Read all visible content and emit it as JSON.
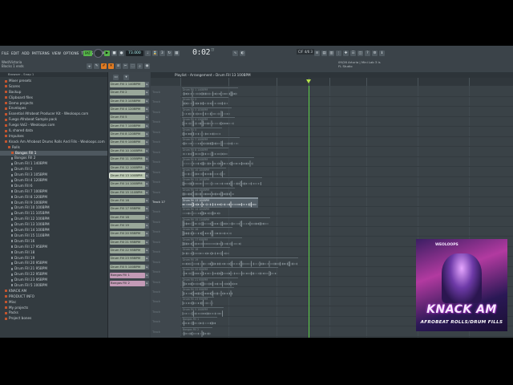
{
  "menu": [
    "FILE",
    "EDIT",
    "ADD",
    "PATTERNS",
    "VIEW",
    "OPTIONS",
    "TOOLS",
    "HELP"
  ],
  "transport": {
    "mode": "PAT",
    "tempo": "73.000",
    "time": "0:02",
    "time_sub": "77",
    "cpu_label": "C/F 4/6 3"
  },
  "pattern_selector": "Pattern 1",
  "hint": {
    "line1": "Wed/Victoria",
    "line2": "Blocks 1 ends"
  },
  "news": {
    "line1": "09/26  Arturia | Mini Lab 3 is",
    "line2": "FL Studio"
  },
  "browser": {
    "header": "Browser - Snap 1",
    "items": [
      {
        "label": "Mixer presets",
        "type": "folder",
        "indent": 1
      },
      {
        "label": "Scores",
        "type": "folder",
        "indent": 1
      },
      {
        "label": "Backup",
        "type": "folder",
        "indent": 1
      },
      {
        "label": "Clipboard files",
        "type": "folder",
        "indent": 1
      },
      {
        "label": "Demo projects",
        "type": "folder",
        "indent": 1
      },
      {
        "label": "Envelopes",
        "type": "folder",
        "indent": 1
      },
      {
        "label": "Essential Afrobeat Producer Kit - Weoloops.com",
        "type": "folder",
        "indent": 1
      },
      {
        "label": "Fuego Afrobeat Sample pack",
        "type": "folder",
        "indent": 1
      },
      {
        "label": "Fuego Vol2 - Weoloops.com",
        "type": "folder",
        "indent": 1
      },
      {
        "label": "IL shared data",
        "type": "folder",
        "indent": 1
      },
      {
        "label": "Impulses",
        "type": "folder",
        "indent": 1
      },
      {
        "label": "Knack Am Afrobeat Drums Rolls And Fills - Weoloops.com",
        "type": "folder",
        "indent": 1
      },
      {
        "label": "Rolls",
        "type": "folder",
        "indent": 2
      },
      {
        "label": "Bongos Fill 1",
        "type": "folder",
        "indent": 3,
        "selected": true
      },
      {
        "label": "Bongos Fill 2",
        "type": "file",
        "indent": 3
      },
      {
        "label": "Drum Fill 1 140BPM",
        "type": "file",
        "indent": 3
      },
      {
        "label": "Drum Fill 2",
        "type": "file",
        "indent": 3
      },
      {
        "label": "Drum Fill 3 105BPM",
        "type": "file",
        "indent": 3
      },
      {
        "label": "Drum Fill 4 120BPM",
        "type": "file",
        "indent": 3
      },
      {
        "label": "Drum Fill 6",
        "type": "file",
        "indent": 3
      },
      {
        "label": "Drum Fill 7 100BPM",
        "type": "file",
        "indent": 3
      },
      {
        "label": "Drum Fill 8 120BPM",
        "type": "file",
        "indent": 3
      },
      {
        "label": "Drum Fill 9 100BPM",
        "type": "file",
        "indent": 3
      },
      {
        "label": "Drum Fill 10 100BPM",
        "type": "file",
        "indent": 3
      },
      {
        "label": "Drum Fill 11 105BPM",
        "type": "file",
        "indent": 3
      },
      {
        "label": "Drum Fill 12 100BPM",
        "type": "file",
        "indent": 3
      },
      {
        "label": "Drum Fill 13 100BPM",
        "type": "file",
        "indent": 3
      },
      {
        "label": "Drum Fill 14 100BPM",
        "type": "file",
        "indent": 3
      },
      {
        "label": "Drum Fill 15 110BPM",
        "type": "file",
        "indent": 3
      },
      {
        "label": "Drum Fill 16",
        "type": "file",
        "indent": 3
      },
      {
        "label": "Drum Fill 17 95BPM",
        "type": "file",
        "indent": 3
      },
      {
        "label": "Drum Fill 18",
        "type": "file",
        "indent": 3
      },
      {
        "label": "Drum Fill 19",
        "type": "file",
        "indent": 3
      },
      {
        "label": "Drum Fill 20 95BPM",
        "type": "file",
        "indent": 3
      },
      {
        "label": "Drum Fill 21 95BPM",
        "type": "file",
        "indent": 3
      },
      {
        "label": "Drum Fill 22 95BPM",
        "type": "file",
        "indent": 3
      },
      {
        "label": "Drum Fill 23 95BPM",
        "type": "file",
        "indent": 3
      },
      {
        "label": "Drum Fill 5 100BPM",
        "type": "file",
        "indent": 3
      },
      {
        "label": "KNACK AM",
        "type": "folder",
        "indent": 1
      },
      {
        "label": "PRODUCT INFO",
        "type": "folder",
        "indent": 1
      },
      {
        "label": "Misc",
        "type": "folder",
        "indent": 1
      },
      {
        "label": "My projects",
        "type": "folder",
        "indent": 1
      },
      {
        "label": "Packs",
        "type": "folder",
        "indent": 1
      },
      {
        "label": "Project bones",
        "type": "folder",
        "indent": 1
      }
    ]
  },
  "channels": [
    {
      "label": "Drum Fill 1 140BPM",
      "color": "green"
    },
    {
      "label": "Drum Fill 2",
      "color": "green"
    },
    {
      "label": "Drum Fill 3 105BPM",
      "color": "green"
    },
    {
      "label": "Drum Fill 4 120BPM",
      "color": "green"
    },
    {
      "label": "Drum Fill 5",
      "color": "green"
    },
    {
      "label": "Drum Fill 7 100BPM",
      "color": "green"
    },
    {
      "label": "Drum Fill 8 120BPM",
      "color": "green"
    },
    {
      "label": "Drum Fill 9 100BPM",
      "color": "green"
    },
    {
      "label": "Drum Fill 10 100BPM",
      "color": "green"
    },
    {
      "label": "Drum Fill 11 105BPM",
      "color": "green"
    },
    {
      "label": "Drum Fill 12 100BPM",
      "color": "green"
    },
    {
      "label": "Drum Fill 13 100BPM",
      "color": "green",
      "selected": true
    },
    {
      "label": "Drum Fill 14 100BPM",
      "color": "green"
    },
    {
      "label": "Drum Fill 15 110BPM",
      "color": "green"
    },
    {
      "label": "Drum Fill 16",
      "color": "green"
    },
    {
      "label": "Drum Fill 17 95BPM",
      "color": "green"
    },
    {
      "label": "Drum Fill 18",
      "color": "green"
    },
    {
      "label": "Drum Fill 19",
      "color": "green"
    },
    {
      "label": "Drum Fill 20 95BPM",
      "color": "green"
    },
    {
      "label": "Drum Fill 21 95BPM",
      "color": "green"
    },
    {
      "label": "Drum Fill 22 95BPM",
      "color": "green"
    },
    {
      "label": "Drum Fill 23 95BPM",
      "color": "green"
    },
    {
      "label": "Drum Fill 5 100BPM",
      "color": "green"
    },
    {
      "label": "Bongos Fill 1",
      "color": "pink"
    },
    {
      "label": "Bongos Fill 2",
      "color": "pink"
    }
  ],
  "playlist": {
    "title": "Playlist - Arrangement › Drum Fill 13 100BPM",
    "active_track": "Track 17",
    "track_label": "Track",
    "clips": [
      "Drum Fill 1 140BPM",
      "Drum Fill 2",
      "Drum Fill 3 105BPM",
      "Drum Fill 4 120BPM",
      "Drum Fill 5",
      "Drum Fill 7 100BPM",
      "Drum Fill 8 120BPM",
      "Drum Fill 9 100BPM",
      "Drum Fill 10 100BPM",
      "Drum Fill 11 105BPM",
      "Drum Fill 12 100BPM",
      "Drum Fill 13 100BPM",
      "Drum Fill 14 100BPM",
      "Drum Fill 15 110BPM",
      "Drum Fill 16",
      "Drum Fill 17 95BPM",
      "Drum Fill 18",
      "Drum Fill 19",
      "Drum Fill 20 95BPM",
      "Drum Fill 21 95BPM",
      "Drum Fill 22 95BPM",
      "Drum Fill 23 95BPM",
      "Drum Fill 5 100BPM",
      "Bongos Fill 1",
      "Bongos Fill 2"
    ],
    "active_clip_index": 11
  },
  "promo": {
    "brand": "WEOLOOPS",
    "title": "KNACK AM",
    "subtitle": "AFROBEAT ROLLS/DRUM FILLS"
  },
  "colors": {
    "playhead": "#5fd04a",
    "accent": "#e07b22",
    "channel_green": "#9aa89a",
    "channel_pink": "#c39ab6"
  }
}
